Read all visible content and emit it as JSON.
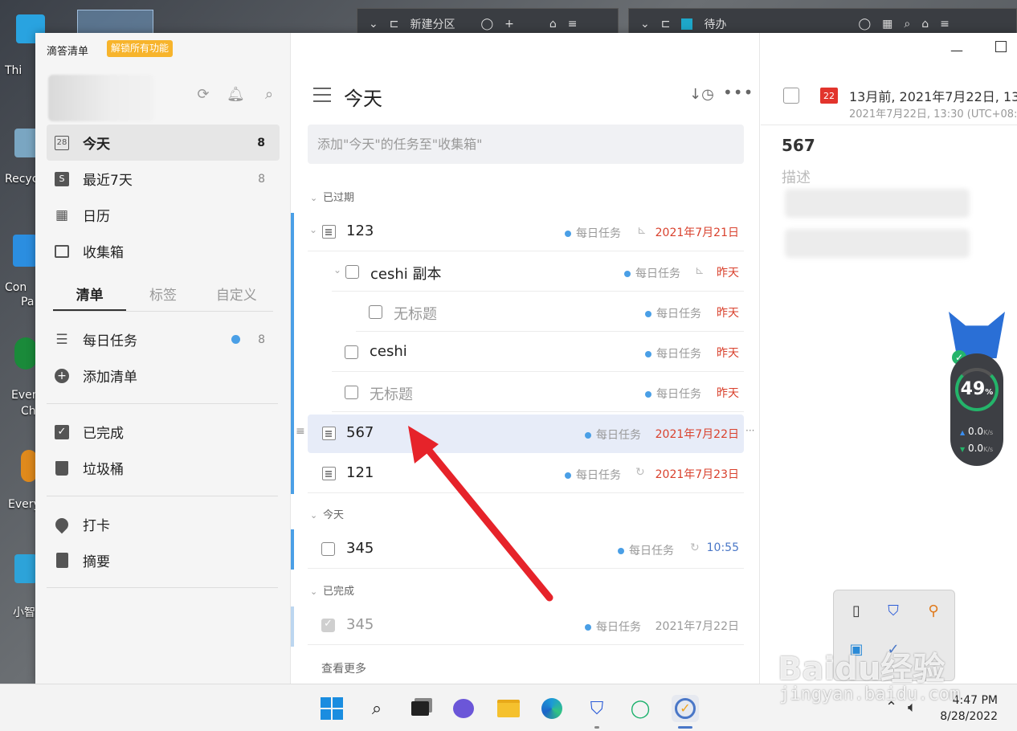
{
  "desktop": {
    "labels": [
      "Thi",
      "Recyc",
      "Con",
      "Pa",
      "Ever",
      "Ch",
      "Every",
      "小智"
    ]
  },
  "bgwindows": {
    "left_tab": "新建分区",
    "right_tab": "待办"
  },
  "app": {
    "name": "滴答清单",
    "unlock_label": "解锁所有功能"
  },
  "sidebar": {
    "smart_lists": [
      {
        "label": "今天",
        "count": "8",
        "icon": "calendar-28-icon",
        "icon_text": "28"
      },
      {
        "label": "最近7天",
        "count": "8",
        "icon": "week-icon",
        "icon_text": "S"
      },
      {
        "label": "日历",
        "count": "",
        "icon": "calendar-icon",
        "icon_text": "▦"
      },
      {
        "label": "收集箱",
        "count": "",
        "icon": "inbox-icon",
        "icon_text": "▭"
      }
    ],
    "tabs": [
      "清单",
      "标签",
      "自定义"
    ],
    "lists": [
      {
        "label": "每日任务",
        "count": "8"
      },
      {
        "label": "添加清单",
        "count": ""
      }
    ],
    "bottom_items": [
      {
        "label": "已完成",
        "icon": "checkbox-icon"
      },
      {
        "label": "垃圾桶",
        "icon": "trash-icon"
      }
    ],
    "extra_items": [
      {
        "label": "打卡",
        "icon": "location-pin-icon"
      },
      {
        "label": "摘要",
        "icon": "summary-icon"
      }
    ]
  },
  "list": {
    "title": "今天",
    "add_placeholder": "添加\"今天\"的任务至\"收集箱\"",
    "sections": {
      "overdue": "已过期",
      "today": "今天",
      "completed": "已完成"
    },
    "rows": [
      {
        "title": "123",
        "tag": "每日任务",
        "date": "2021年7月21日"
      },
      {
        "title": "ceshi  副本",
        "tag": "每日任务",
        "date": "昨天"
      },
      {
        "title": "无标题",
        "tag": "每日任务",
        "date": "昨天"
      },
      {
        "title": "ceshi",
        "tag": "每日任务",
        "date": "昨天"
      },
      {
        "title": "无标题",
        "tag": "每日任务",
        "date": "昨天"
      },
      {
        "title": "567",
        "tag": "每日任务",
        "date": "2021年7月22日"
      },
      {
        "title": "121",
        "tag": "每日任务",
        "date": "2021年7月23日"
      },
      {
        "title": "345",
        "tag": "每日任务",
        "date": "10:55"
      },
      {
        "title": "345",
        "tag": "每日任务",
        "date": "2021年7月22日"
      }
    ],
    "see_more": "查看更多"
  },
  "detail": {
    "cal_day": "22",
    "date_line": "13月前, 2021年7月22日, 13",
    "date_sub": "2021年7月22日, 13:30 (UTC+08:",
    "title": "567",
    "desc_placeholder": "描述"
  },
  "speed_widget": {
    "percent": "49",
    "percent_unit": "%",
    "up": "0.0",
    "down": "0.0",
    "unit": "K/s"
  },
  "taskbar": {
    "time": "4:47 PM",
    "date": "8/28/2022"
  },
  "watermark": {
    "brand": "Baidu经验",
    "url": "jingyan.baidu.com"
  },
  "colors": {
    "accent": "#4a9fe6",
    "overdue": "#d9412d",
    "selected_row": "#e7ecf8",
    "arrow": "#e6232a"
  }
}
